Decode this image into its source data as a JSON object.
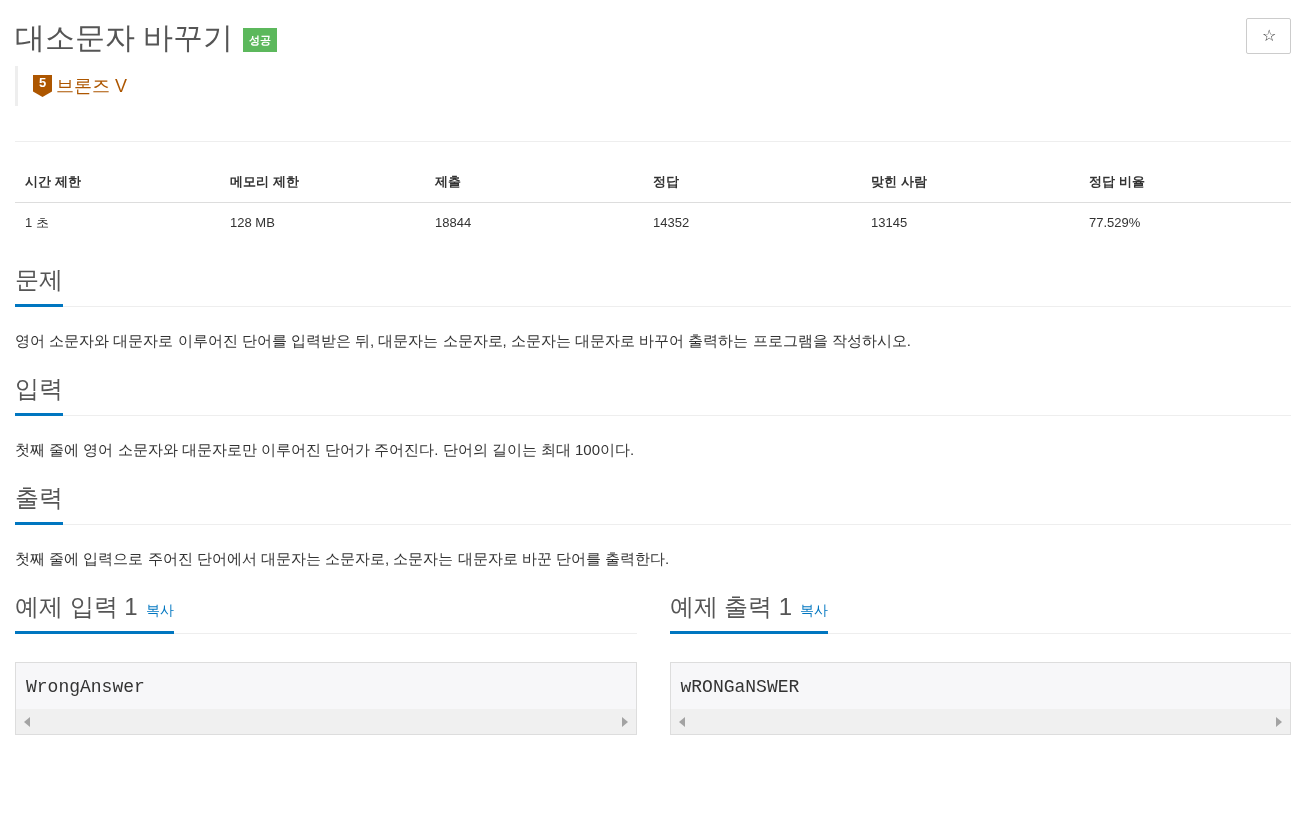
{
  "problem": {
    "title": "대소문자 바꾸기",
    "result_badge": "성공",
    "tier": {
      "badge_number": "5",
      "label": "브론즈 V"
    }
  },
  "favorite_button": "☆",
  "info_table": {
    "columns": [
      "시간 제한",
      "메모리 제한",
      "제출",
      "정답",
      "맞힌 사람",
      "정답 비율"
    ],
    "rows": [
      [
        "1 초",
        "128 MB",
        "18844",
        "14352",
        "13145",
        "77.529%"
      ]
    ]
  },
  "sections": [
    {
      "heading": "문제",
      "body": "영어 소문자와 대문자로 이루어진 단어를 입력받은 뒤, 대문자는 소문자로, 소문자는 대문자로 바꾸어 출력하는 프로그램을 작성하시오."
    },
    {
      "heading": "입력",
      "body": "첫째 줄에 영어 소문자와 대문자로만 이루어진 단어가 주어진다. 단어의 길이는 최대 100이다."
    },
    {
      "heading": "출력",
      "body": "첫째 줄에 입력으로 주어진 단어에서 대문자는 소문자로, 소문자는 대문자로 바꾼 단어를 출력한다."
    }
  ],
  "samples": [
    {
      "heading": "예제 입력 1",
      "copy_link": "복사",
      "content": "WrongAnswer"
    },
    {
      "heading": "예제 출력 1",
      "copy_link": "복사",
      "content": "wRONGaNSWER"
    }
  ]
}
